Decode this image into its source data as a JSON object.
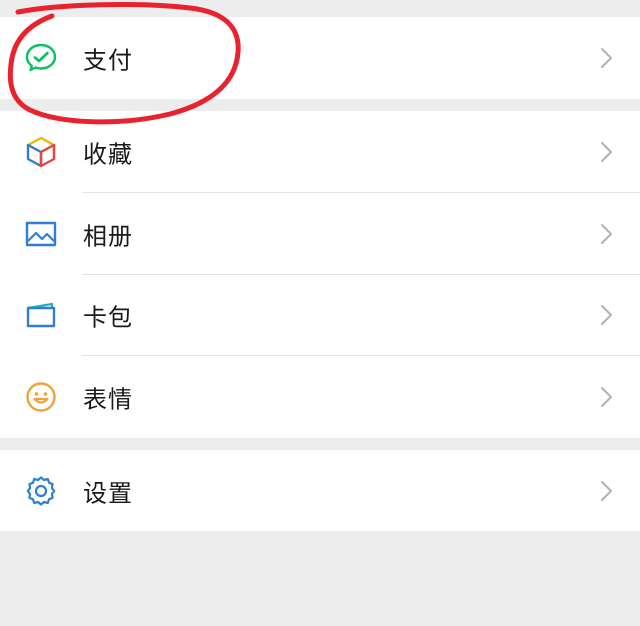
{
  "menu": {
    "groups": [
      {
        "items": [
          {
            "label": "支付",
            "icon": "wechat-pay-icon"
          }
        ]
      },
      {
        "items": [
          {
            "label": "收藏",
            "icon": "favorites-cube-icon"
          },
          {
            "label": "相册",
            "icon": "photo-album-icon"
          },
          {
            "label": "卡包",
            "icon": "card-wallet-icon"
          },
          {
            "label": "表情",
            "icon": "smiley-icon"
          }
        ]
      },
      {
        "items": [
          {
            "label": "设置",
            "icon": "gear-icon"
          }
        ]
      }
    ]
  },
  "colors": {
    "background": "#ededed",
    "row_background": "#ffffff",
    "pay_green": "#07c160",
    "accent_blue": "#2f7fd0",
    "smiley_orange": "#f0a23a",
    "annotation_red": "#e8232f",
    "chevron_gray": "#b2b2b2"
  },
  "annotation": {
    "type": "hand-drawn-circle",
    "target": "支付"
  }
}
